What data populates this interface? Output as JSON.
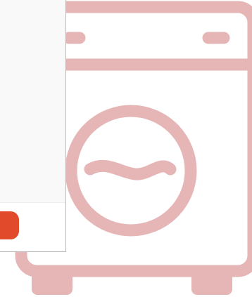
{
  "illustration": {
    "icon": "washing-machine-icon",
    "color": "#e6b5b6"
  },
  "modal": {
    "body_color": "#f9f9f9",
    "border_color": "#b9b9b9",
    "primary_button": {
      "label": "",
      "color": "#e14b2c"
    }
  }
}
